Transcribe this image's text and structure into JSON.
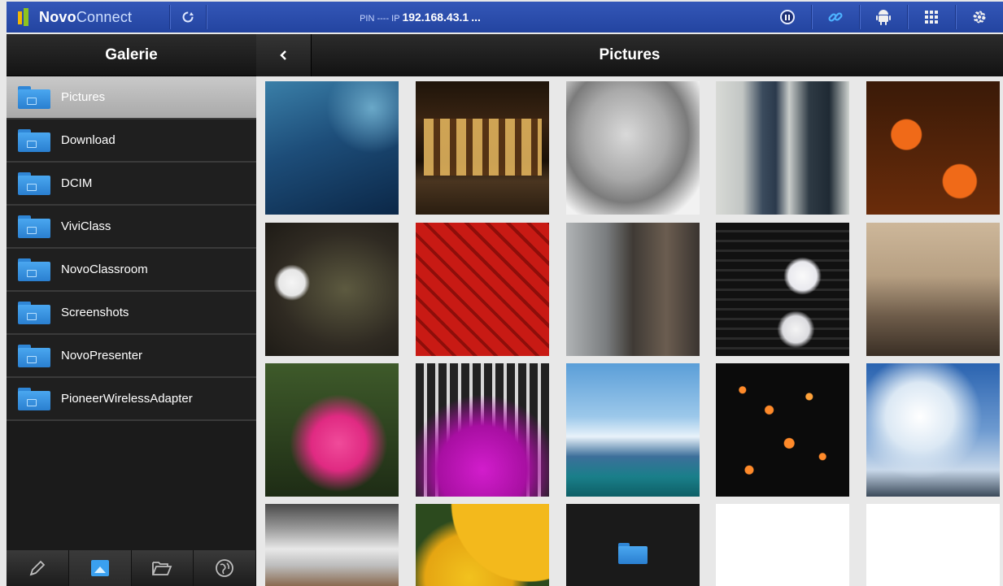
{
  "topbar": {
    "app_name_bold": "Novo",
    "app_name_light": "Connect",
    "pin_ip_prefix": "PIN ---- IP",
    "ip_address": "192.168.43.1",
    "ip_suffix": "...",
    "accent_color": "#2a4bb0"
  },
  "sidebar": {
    "title": "Galerie",
    "folders": [
      {
        "label": "Pictures",
        "selected": true
      },
      {
        "label": "Download",
        "selected": false
      },
      {
        "label": "DCIM",
        "selected": false
      },
      {
        "label": "ViviClass",
        "selected": false
      },
      {
        "label": "NovoClassroom",
        "selected": false
      },
      {
        "label": "Screenshots",
        "selected": false
      },
      {
        "label": "NovoPresenter",
        "selected": false
      },
      {
        "label": "PioneerWirelessAdapter",
        "selected": false
      }
    ],
    "footer_tabs": [
      "pencil-icon",
      "picture-icon",
      "folder-open-icon",
      "globe-icon"
    ],
    "active_footer_tab": "picture-icon"
  },
  "main": {
    "title": "Pictures",
    "back_icon": "chevron-left-icon",
    "thumbnails": [
      "lake-water",
      "lit-building-night",
      "sleeping-kitten",
      "couple-jeans",
      "clownfish",
      "white-flower",
      "red-pattern",
      "cat-window",
      "orchid-wine-rack",
      "palace-facade",
      "pink-lily",
      "purple-orchids",
      "harbor-ship",
      "sky-lanterns",
      "cloudy-sky",
      "river-rocks",
      "sunflower",
      "folder",
      "empty",
      "empty"
    ]
  }
}
